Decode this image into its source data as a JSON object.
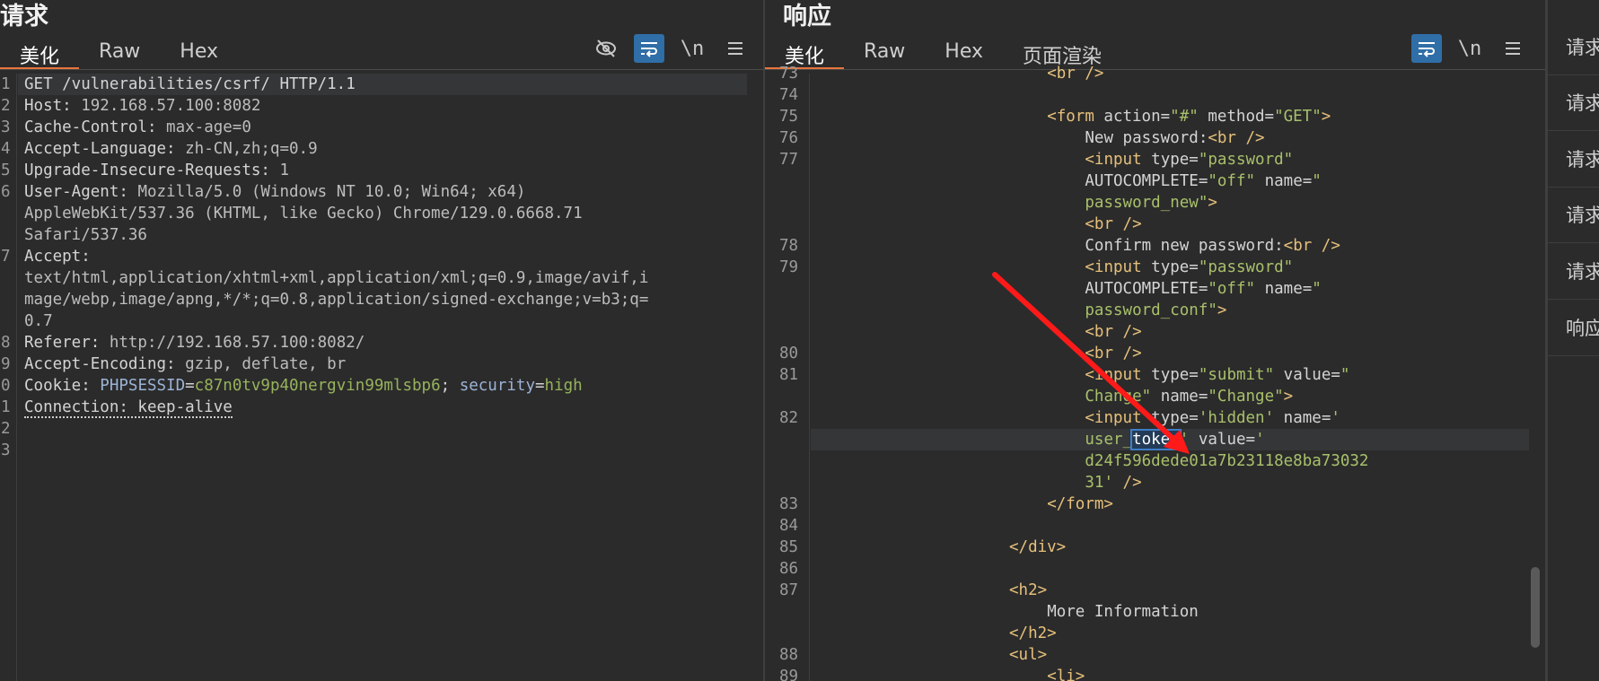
{
  "request": {
    "title": "请求",
    "tabs": [
      "美化",
      "Raw",
      "Hex"
    ],
    "tools": {
      "hide_icon": "eye-slash-icon",
      "wrap_icon": "wrap-lines-icon",
      "newline": "\\n",
      "menu_icon": "hamburger-menu-icon"
    },
    "lines": [
      {
        "n": "1",
        "parts": [
          {
            "t": "GET /vulnerabilities/csrf/ HTTP/1.1",
            "c": "key"
          }
        ]
      },
      {
        "n": "2",
        "parts": [
          {
            "t": "Host: ",
            "c": "key"
          },
          {
            "t": "192.168.57.100:8082",
            "c": "val"
          }
        ]
      },
      {
        "n": "3",
        "parts": [
          {
            "t": "Cache-Control: ",
            "c": "key"
          },
          {
            "t": "max-age=0",
            "c": "val"
          }
        ]
      },
      {
        "n": "4",
        "parts": [
          {
            "t": "Accept-Language: ",
            "c": "key"
          },
          {
            "t": "zh-CN,zh;q=0.9",
            "c": "val"
          }
        ]
      },
      {
        "n": "5",
        "parts": [
          {
            "t": "Upgrade-Insecure-Requests: ",
            "c": "key"
          },
          {
            "t": "1",
            "c": "val"
          }
        ]
      },
      {
        "n": "6",
        "parts": [
          {
            "t": "User-Agent: ",
            "c": "key"
          },
          {
            "t": "Mozilla/5.0 (Windows NT 10.0; Win64; x64)",
            "c": "val"
          }
        ]
      },
      {
        "n": "",
        "parts": [
          {
            "t": "AppleWebKit/537.36 (KHTML, like Gecko) Chrome/129.0.6668.71",
            "c": "val"
          }
        ]
      },
      {
        "n": "",
        "parts": [
          {
            "t": "Safari/537.36",
            "c": "val"
          }
        ]
      },
      {
        "n": "7",
        "parts": [
          {
            "t": "Accept: ",
            "c": "key"
          }
        ]
      },
      {
        "n": "",
        "parts": [
          {
            "t": "text/html,application/xhtml+xml,application/xml;q=0.9,image/avif,i",
            "c": "val"
          }
        ]
      },
      {
        "n": "",
        "parts": [
          {
            "t": "mage/webp,image/apng,*/*;q=0.8,application/signed-exchange;v=b3;q=",
            "c": "val"
          }
        ]
      },
      {
        "n": "",
        "parts": [
          {
            "t": "0.7",
            "c": "val"
          }
        ]
      },
      {
        "n": "8",
        "parts": [
          {
            "t": "Referer: ",
            "c": "key"
          },
          {
            "t": "http://192.168.57.100:8082/",
            "c": "val"
          }
        ]
      },
      {
        "n": "9",
        "parts": [
          {
            "t": "Accept-Encoding: ",
            "c": "key"
          },
          {
            "t": "gzip, deflate, br",
            "c": "val"
          }
        ]
      },
      {
        "n": "0",
        "parts": [
          {
            "t": "Cookie: ",
            "c": "key"
          },
          {
            "t": "PHPSESSID",
            "c": "cookie-name"
          },
          {
            "t": "=",
            "c": "key"
          },
          {
            "t": "c87n0tv9p40nergvin99mlsbp6",
            "c": "cookie-val"
          },
          {
            "t": "; ",
            "c": "key"
          },
          {
            "t": "security",
            "c": "cookie-name"
          },
          {
            "t": "=",
            "c": "key"
          },
          {
            "t": "high",
            "c": "cookie-val"
          }
        ]
      },
      {
        "n": "1",
        "parts": [
          {
            "t": "Connection: keep-alive",
            "c": "key dotted"
          }
        ]
      },
      {
        "n": "2",
        "parts": []
      },
      {
        "n": "3",
        "parts": []
      }
    ]
  },
  "response": {
    "title": "响应",
    "tabs": [
      "美化",
      "Raw",
      "Hex",
      "页面渲染"
    ],
    "tools": {
      "wrap_icon": "wrap-lines-icon",
      "newline": "\\n",
      "menu_icon": "hamburger-menu-icon"
    },
    "lines": [
      {
        "n": "73",
        "indent": 12,
        "parts": [
          {
            "t": "<br />",
            "c": "tag"
          }
        ]
      },
      {
        "n": "74",
        "indent": 0,
        "parts": []
      },
      {
        "n": "75",
        "indent": 12,
        "parts": [
          {
            "t": "<form ",
            "c": "tag"
          },
          {
            "t": "action=",
            "c": "attr"
          },
          {
            "t": "\"#\"",
            "c": "str"
          },
          {
            "t": " method=",
            "c": "attr"
          },
          {
            "t": "\"GET\"",
            "c": "str"
          },
          {
            "t": ">",
            "c": "tag"
          }
        ]
      },
      {
        "n": "76",
        "indent": 14,
        "parts": [
          {
            "t": "New password:",
            "c": "attr"
          },
          {
            "t": "<br />",
            "c": "tag"
          }
        ]
      },
      {
        "n": "77",
        "indent": 14,
        "parts": [
          {
            "t": "<input ",
            "c": "tag"
          },
          {
            "t": "type=",
            "c": "attr"
          },
          {
            "t": "\"password\"",
            "c": "str"
          }
        ]
      },
      {
        "n": "",
        "indent": 14,
        "parts": [
          {
            "t": "AUTOCOMPLETE=",
            "c": "attr"
          },
          {
            "t": "\"off\"",
            "c": "str"
          },
          {
            "t": " name=",
            "c": "attr"
          },
          {
            "t": "\"",
            "c": "str"
          }
        ]
      },
      {
        "n": "",
        "indent": 14,
        "parts": [
          {
            "t": "password_new\"",
            "c": "str"
          },
          {
            "t": ">",
            "c": "tag"
          }
        ]
      },
      {
        "n": "",
        "indent": 14,
        "parts": [
          {
            "t": "<br />",
            "c": "tag"
          }
        ]
      },
      {
        "n": "78",
        "indent": 14,
        "parts": [
          {
            "t": "Confirm new password:",
            "c": "attr"
          },
          {
            "t": "<br />",
            "c": "tag"
          }
        ]
      },
      {
        "n": "79",
        "indent": 14,
        "parts": [
          {
            "t": "<input ",
            "c": "tag"
          },
          {
            "t": "type=",
            "c": "attr"
          },
          {
            "t": "\"password\"",
            "c": "str"
          }
        ]
      },
      {
        "n": "",
        "indent": 14,
        "parts": [
          {
            "t": "AUTOCOMPLETE=",
            "c": "attr"
          },
          {
            "t": "\"off\"",
            "c": "str"
          },
          {
            "t": " name=",
            "c": "attr"
          },
          {
            "t": "\"",
            "c": "str"
          }
        ]
      },
      {
        "n": "",
        "indent": 14,
        "parts": [
          {
            "t": "password_conf\"",
            "c": "str"
          },
          {
            "t": ">",
            "c": "tag"
          }
        ]
      },
      {
        "n": "",
        "indent": 14,
        "parts": [
          {
            "t": "<br />",
            "c": "tag"
          }
        ]
      },
      {
        "n": "80",
        "indent": 14,
        "parts": [
          {
            "t": "<br />",
            "c": "tag"
          }
        ]
      },
      {
        "n": "81",
        "indent": 14,
        "parts": [
          {
            "t": "<input ",
            "c": "tag"
          },
          {
            "t": "type=",
            "c": "attr"
          },
          {
            "t": "\"submit\"",
            "c": "str"
          },
          {
            "t": " value=",
            "c": "attr"
          },
          {
            "t": "\"",
            "c": "str"
          }
        ]
      },
      {
        "n": "",
        "indent": 14,
        "parts": [
          {
            "t": "Change\"",
            "c": "str"
          },
          {
            "t": " name=",
            "c": "attr"
          },
          {
            "t": "\"Change\"",
            "c": "str"
          },
          {
            "t": ">",
            "c": "tag"
          }
        ]
      },
      {
        "n": "82",
        "indent": 14,
        "parts": [
          {
            "t": "<input ",
            "c": "tag"
          },
          {
            "t": "type=",
            "c": "attr"
          },
          {
            "t": "'hidden'",
            "c": "str"
          },
          {
            "t": " name=",
            "c": "attr"
          },
          {
            "t": "'",
            "c": "str"
          }
        ]
      },
      {
        "n": "",
        "indent": 14,
        "hl": true,
        "parts": [
          {
            "t": "user_",
            "c": "str"
          },
          {
            "t": "token",
            "c": "str sel"
          },
          {
            "t": "'",
            "c": "str"
          },
          {
            "t": " value=",
            "c": "attr"
          },
          {
            "t": "'",
            "c": "str"
          }
        ]
      },
      {
        "n": "",
        "indent": 14,
        "parts": [
          {
            "t": "d24f596dede01a7b23118e8ba73032",
            "c": "str"
          }
        ]
      },
      {
        "n": "",
        "indent": 14,
        "parts": [
          {
            "t": "31'",
            "c": "str"
          },
          {
            "t": " />",
            "c": "tag"
          }
        ]
      },
      {
        "n": "83",
        "indent": 12,
        "parts": [
          {
            "t": "</form>",
            "c": "tag"
          }
        ]
      },
      {
        "n": "84",
        "indent": 0,
        "parts": []
      },
      {
        "n": "85",
        "indent": 10,
        "parts": [
          {
            "t": "</div>",
            "c": "tag"
          }
        ]
      },
      {
        "n": "86",
        "indent": 0,
        "parts": []
      },
      {
        "n": "87",
        "indent": 10,
        "parts": [
          {
            "t": "<h2>",
            "c": "tag"
          }
        ]
      },
      {
        "n": "",
        "indent": 12,
        "parts": [
          {
            "t": "More Information",
            "c": "attr"
          }
        ]
      },
      {
        "n": "",
        "indent": 10,
        "parts": [
          {
            "t": "</h2>",
            "c": "tag"
          }
        ]
      },
      {
        "n": "88",
        "indent": 10,
        "parts": [
          {
            "t": "<ul>",
            "c": "tag"
          }
        ]
      },
      {
        "n": "89",
        "indent": 12,
        "parts": [
          {
            "t": "<li>",
            "c": "tag"
          }
        ]
      }
    ]
  },
  "sidebar": {
    "items": [
      "请求",
      "请求",
      "请求",
      "请求",
      "请求",
      "响应"
    ]
  },
  "colors": {
    "accent": "#e8743b",
    "toggle_on": "#2f6ea7",
    "annotation_arrow": "#ff1a1a"
  }
}
